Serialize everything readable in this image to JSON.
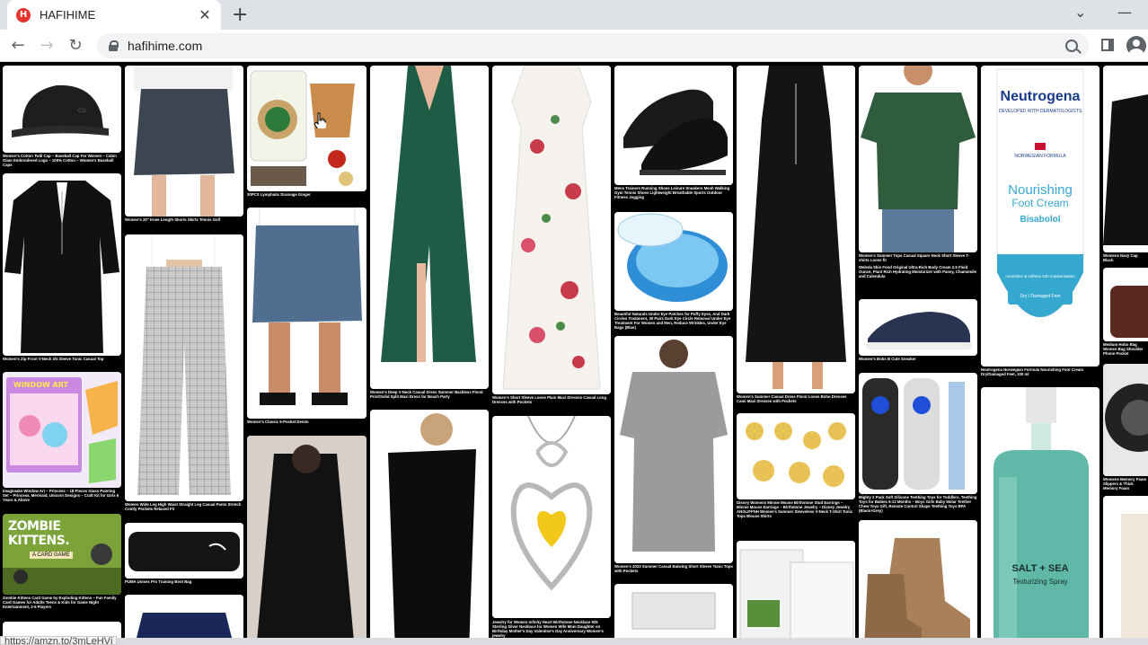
{
  "browser": {
    "tab_title": "HAFIHIME",
    "favicon_letter": "H",
    "url": "hafihime.com",
    "status_url": "https://amzn.to/3mLeHVj",
    "new_tab_symbol": "+",
    "close_symbol": "✕"
  },
  "products": [
    {
      "id": "cap",
      "caption": "Women's Cotton Twill Cap – Baseball Cap For Women – Cabin Glam Embroidered Logo – 100% Cotton – Women's Baseball Caps",
      "color": "#222"
    },
    {
      "id": "zip-tunic",
      "caption": "Women's Zip Front V-Neck 3/4 Sleeve Tunic Casual Top",
      "color": "#111"
    },
    {
      "id": "window-art",
      "caption": "Imagimake Window Art – Princess – 18 Pieces Glass Painting Set – Princess, Mermaid, Unicorn Designs – Craft Kit for Girls 6 Years & Above",
      "color": "#d9a6e8"
    },
    {
      "id": "zombie-kittens",
      "caption": "Zombie Kittens Card Game by Exploding Kittens – Fun Family Card Games for Adults Teens & Kids for Game Night Entertainment, 2-5 Players",
      "color": "#6a9b2e"
    },
    {
      "id": "skort",
      "caption": "Women's 20\" Knee Length Skorts Skirts Tennis Golf",
      "color": "#3c4652"
    },
    {
      "id": "plaid-pants",
      "caption": "Women Wide Leg High Waist Straight Leg Casual Pants Stretch Comfy Pockets Relaxed Fit",
      "color": "#bfbfbf"
    },
    {
      "id": "puma-bag",
      "caption": "PUMA Unisex Pro Training Boot Bag",
      "color": "#151515"
    },
    {
      "id": "foot-bath",
      "caption": "30PCS Lymphatic Drainage Ginger",
      "color": "#e9d7b8"
    },
    {
      "id": "denim-skirt",
      "caption": "Women's Classic 5-Pocket Denim",
      "color": "#4f6e90"
    },
    {
      "id": "green-dress",
      "caption": "Women's Deep V-Neck Casual Dress Summer Backless Floral Print/Solid Split Maxi Dress for Beach Party",
      "color": "#1f5c45"
    },
    {
      "id": "floral-dress",
      "caption": "Women's Short Sleeve Loose Plain Maxi Dresses Casual Long Dresses with Pockets",
      "color": "#f5f2ee"
    },
    {
      "id": "necklace",
      "caption": "Jewelry for Women Infinity Heart Birthstone Necklace 925 Sterling Silver Necklace for Women Wife Mom Daughter on Birthday Mother's Day Valentine's Day Anniversary Women's jewelry",
      "color": "#e6e6e6"
    },
    {
      "id": "sneakers",
      "caption": "Mens Trainers Running Shoes Leisure Sneakers Mesh Walking Gym Tennis Shoes Lightweight Breathable Sports Outdoor Fitness Jogging",
      "color": "#1a1a1a"
    },
    {
      "id": "eye-patches",
      "caption": "Beautiful Naturals Under Eye Patches for Puffy Eyes, And Dark Circles Treatment, 30 Pairs Dark Eye Circle Removal Under Eye Treatment For Women and Men, Reduce Wrinkles, Under Eye Bags (Blue)",
      "color": "#2e8fd6"
    },
    {
      "id": "grey-tunic",
      "caption": "Women's 2023 Summer Casual Batwing Short Sleeve Tunic Tops with Pockets",
      "color": "#9b9b9b"
    },
    {
      "id": "black-dress",
      "caption": "Women's Summer Casual Dress Floral Loose Boho Dresses Cami Maxi Dresses with Pockets",
      "color": "#141414"
    },
    {
      "id": "earrings",
      "caption": "Disney Womens Minnie Mouse Birthstone Stud Earrings – Minnie Mouse Earrings – Birthstone Jewelry – Disney Jewelry",
      "color": "#e8c254"
    },
    {
      "id": "sleeveless-top",
      "caption": "ANGLIFFNH Women's Summer Sleeveless V-Neck T-Shirt Tunic Tops Blouse Shirts",
      "color": "#e8e8e8"
    },
    {
      "id": "green-blouse",
      "caption": "Women's Summer Tops Casual Square Neck Short Sleeve T-shirts Loose fit",
      "color": "#2f5c3d"
    },
    {
      "id": "body-cream",
      "caption": "Weleda Skin Food Original Ultra-Rich Body Cream 2.5 Fluid Ounce, Plant Rich Hydrating Moisturizer with Pansy, Chamomile and Calendula",
      "color": "#000"
    },
    {
      "id": "canvas-shoes",
      "caption": "Women's Bobs B Cute Sneaker",
      "color": "#2a3450"
    },
    {
      "id": "teethers",
      "caption": "Mighty 2 Pack Soft Silicone Teething Toys for Toddlers, Teething Toys for Babies 6-12 Months – Boys Girls Baby Molar Teether Chew Toys Gift, Remote Control Shape Teething Toys BPA (Black+Grey)",
      "color": "#2a2a2a"
    },
    {
      "id": "boots",
      "caption": "",
      "color": "#a8805a"
    },
    {
      "id": "neutrogena",
      "caption": "Neutrogena Norwegian Formula Nourishing Foot Cream Dry/Damaged Feet, 100 ml",
      "color": "#35a8cf"
    },
    {
      "id": "salt-spray",
      "caption": "",
      "color": "#5fb8a8"
    },
    {
      "id": "baseball-cap-2",
      "caption": "Womens Navy Cap Black",
      "color": "#111"
    },
    {
      "id": "handbag",
      "caption": "Medium Hobo Bag Women Bag Shoulder Phone Pocket",
      "color": "#5b2a1e"
    },
    {
      "id": "memory-foam",
      "caption": "Womens Memory Foam Slippers & Thick Memory Foam",
      "color": "#222"
    }
  ],
  "neutrogena_label": {
    "brand": "Neutrogena",
    "tagline": "DEVELOPED WITH DERMATOLOGISTS",
    "formula": "NORWEGIAN FORMULA",
    "title1": "Nourishing",
    "title2": "Foot Cream",
    "title3": "Bisabolol",
    "sub": "nourishes & softens 24h moisturisation",
    "badge": "Dry / Damaged Feet"
  },
  "salt_spray_label": {
    "line1": "SALT + SEA",
    "line2": "Texturizing Spray"
  },
  "zombie_label": {
    "line1": "ZOMBIE KITTENS.",
    "line2": "A CARD GAME"
  },
  "window_art_label": "WINDOW ART",
  "colors": {
    "accent": "#e8312c",
    "chrome": "#dee1e6",
    "omnibox": "#f1f3f4"
  }
}
